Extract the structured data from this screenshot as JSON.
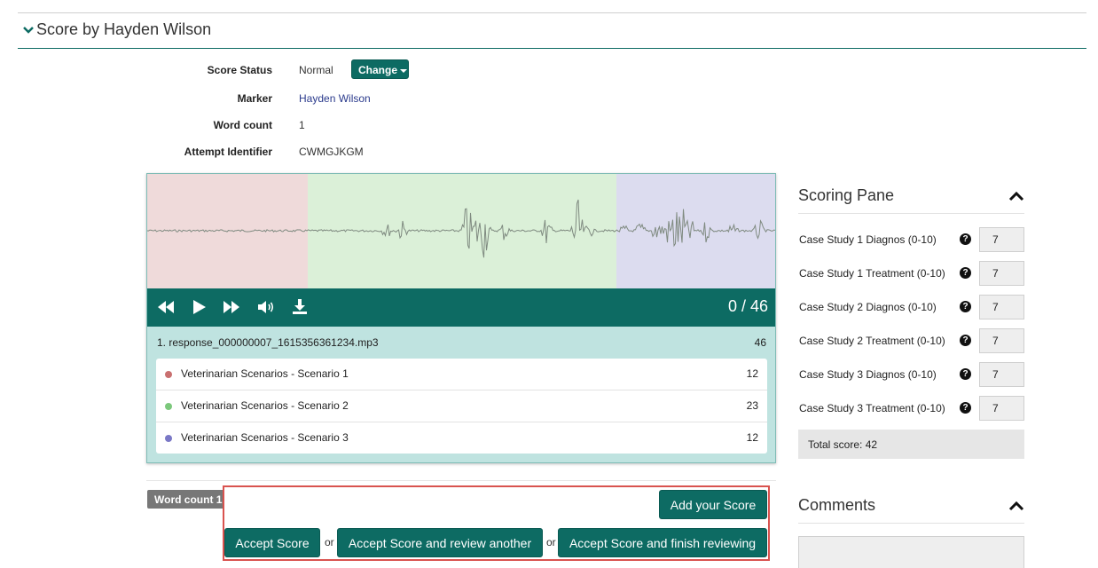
{
  "section": {
    "title": "Score by Hayden Wilson"
  },
  "meta": {
    "score_status_label": "Score Status",
    "score_status_value": "Normal",
    "change_label": "Change",
    "marker_label": "Marker",
    "marker_value": "Hayden Wilson",
    "word_count_label": "Word count",
    "word_count_value": "1",
    "attempt_label": "Attempt Identifier",
    "attempt_value": "CWMGJKGM"
  },
  "player": {
    "time": "0 / 46",
    "file_name": "1. response_000000007_1615356361234.mp3",
    "file_count": "46",
    "segments": [
      {
        "name": "Veterinarian Scenarios - Scenario 1",
        "count": "12",
        "color": "#c97070"
      },
      {
        "name": "Veterinarian Scenarios - Scenario 2",
        "count": "23",
        "color": "#7cc87c"
      },
      {
        "name": "Veterinarian Scenarios - Scenario 3",
        "count": "12",
        "color": "#7a78c6"
      }
    ],
    "region_colors": [
      "#efdada",
      "#dbf0d8",
      "#dcdcef"
    ]
  },
  "actions": {
    "word_count_badge": "Word count 1",
    "add_score": "Add your Score",
    "accept": "Accept Score",
    "or1": "or",
    "accept_review": "Accept Score and review another",
    "or2": "or",
    "accept_finish": "Accept Score and finish reviewing"
  },
  "scoring": {
    "title": "Scoring Pane",
    "criteria": [
      {
        "label": "Case Study 1 Diagnos (0-10)",
        "value": "7"
      },
      {
        "label": "Case Study 1 Treatment (0-10)",
        "value": "7"
      },
      {
        "label": "Case Study 2 Diagnos (0-10)",
        "value": "7"
      },
      {
        "label": "Case Study 2 Treatment (0-10)",
        "value": "7"
      },
      {
        "label": "Case Study 3 Diagnos (0-10)",
        "value": "7"
      },
      {
        "label": "Case Study 3 Treatment (0-10)",
        "value": "7"
      }
    ],
    "total": "Total score: 42"
  },
  "comments": {
    "title": "Comments"
  },
  "colors": {
    "accent": "#0d6b63",
    "highlight_border": "#d9534f"
  }
}
